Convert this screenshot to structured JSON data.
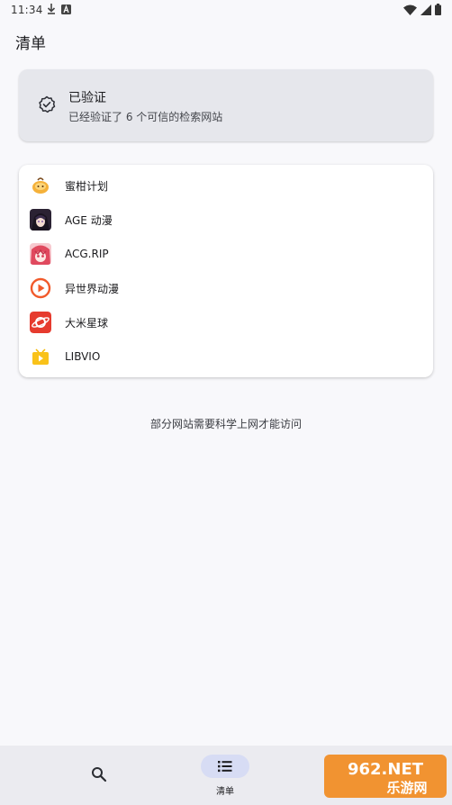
{
  "status_bar": {
    "time": "11:34",
    "left_icons": [
      "download-icon",
      "a-icon"
    ],
    "right_icons": [
      "wifi-icon",
      "signal-icon",
      "battery-icon"
    ]
  },
  "page": {
    "title": "清单"
  },
  "verified": {
    "title": "已验证",
    "subtitle": "已经验证了 6 个可信的检索网站",
    "icon": "verified-badge-icon"
  },
  "sites": [
    {
      "label": "蜜柑计划",
      "icon": "mikan-icon"
    },
    {
      "label": "AGE 动漫",
      "icon": "age-icon"
    },
    {
      "label": "ACG.RIP",
      "icon": "acgrip-icon"
    },
    {
      "label": "异世界动漫",
      "icon": "isekai-icon"
    },
    {
      "label": "大米星球",
      "icon": "dami-icon"
    },
    {
      "label": "LIBVIO",
      "icon": "libvio-icon"
    }
  ],
  "note": "部分网站需要科学上网才能访问",
  "bottom_nav": {
    "search_icon": "search-icon",
    "list_icon": "list-icon",
    "list_label": "清单"
  },
  "watermark": {
    "text_top": "962.NET",
    "text_bottom": "乐游网"
  },
  "colors": {
    "background": "#f8f8fb",
    "verified_card": "#e6e7ec",
    "nav_active_pill": "#d7dcf4",
    "bottom_nav": "#ebebf0"
  }
}
